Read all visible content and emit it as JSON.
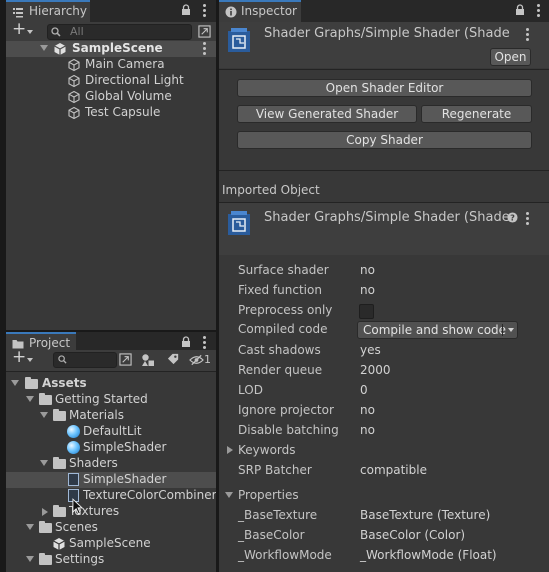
{
  "hierarchy": {
    "tab_label": "Hierarchy",
    "add_label": "+",
    "search_placeholder": "All",
    "scene_name": "SampleScene",
    "items": [
      {
        "label": "Main Camera"
      },
      {
        "label": "Directional Light"
      },
      {
        "label": "Global Volume"
      },
      {
        "label": "Test Capsule"
      }
    ]
  },
  "project": {
    "tab_label": "Project",
    "add_label": "+",
    "hidden_count": "1",
    "tree": [
      {
        "label": "Assets",
        "kind": "folder"
      },
      {
        "label": "Getting Started",
        "kind": "folder"
      },
      {
        "label": "Materials",
        "kind": "folder"
      },
      {
        "label": "DefaultLit",
        "kind": "material"
      },
      {
        "label": "SimpleShader",
        "kind": "material"
      },
      {
        "label": "Shaders",
        "kind": "folder"
      },
      {
        "label": "SimpleShader",
        "kind": "shadergraph",
        "selected": true
      },
      {
        "label": "TextureColorCombiner",
        "kind": "shadergraph"
      },
      {
        "label": "Textures",
        "kind": "folder",
        "collapsed": true
      },
      {
        "label": "Scenes",
        "kind": "folder"
      },
      {
        "label": "SampleScene",
        "kind": "scene"
      },
      {
        "label": "Settings",
        "kind": "folder"
      }
    ]
  },
  "inspector": {
    "tab_label": "Inspector",
    "header_title": "Shader Graphs/Simple Shader (Shade",
    "open_label": "Open",
    "open_editor_label": "Open Shader Editor",
    "view_generated_label": "View Generated Shader",
    "regenerate_label": "Regenerate",
    "copy_shader_label": "Copy Shader",
    "imported_object_label": "Imported Object",
    "imported_title": "Shader Graphs/Simple Shader (Shade",
    "properties": [
      {
        "label": "Surface shader",
        "value": "no"
      },
      {
        "label": "Fixed function",
        "value": "no"
      },
      {
        "label": "Preprocess only",
        "value": ""
      },
      {
        "label": "Compiled code",
        "value": "Compile and show code"
      },
      {
        "label": "Cast shadows",
        "value": "yes"
      },
      {
        "label": "Render queue",
        "value": "2000"
      },
      {
        "label": "LOD",
        "value": "0"
      },
      {
        "label": "Ignore projector",
        "value": "no"
      },
      {
        "label": "Disable batching",
        "value": "no"
      }
    ],
    "keywords_label": "Keywords",
    "srp_batcher_label": "SRP Batcher",
    "srp_batcher_value": "compatible",
    "properties_label": "Properties",
    "shader_properties": [
      {
        "label": "_BaseTexture",
        "value": "BaseTexture (Texture)"
      },
      {
        "label": "_BaseColor",
        "value": "BaseColor (Color)"
      },
      {
        "label": "_WorkflowMode",
        "value": "_WorkflowMode (Float)"
      }
    ]
  },
  "colors": {
    "accent": "#3a79bb",
    "panel": "#383838",
    "tab_bar": "#282828",
    "button": "#585858",
    "selection": "#4d4d4d"
  }
}
